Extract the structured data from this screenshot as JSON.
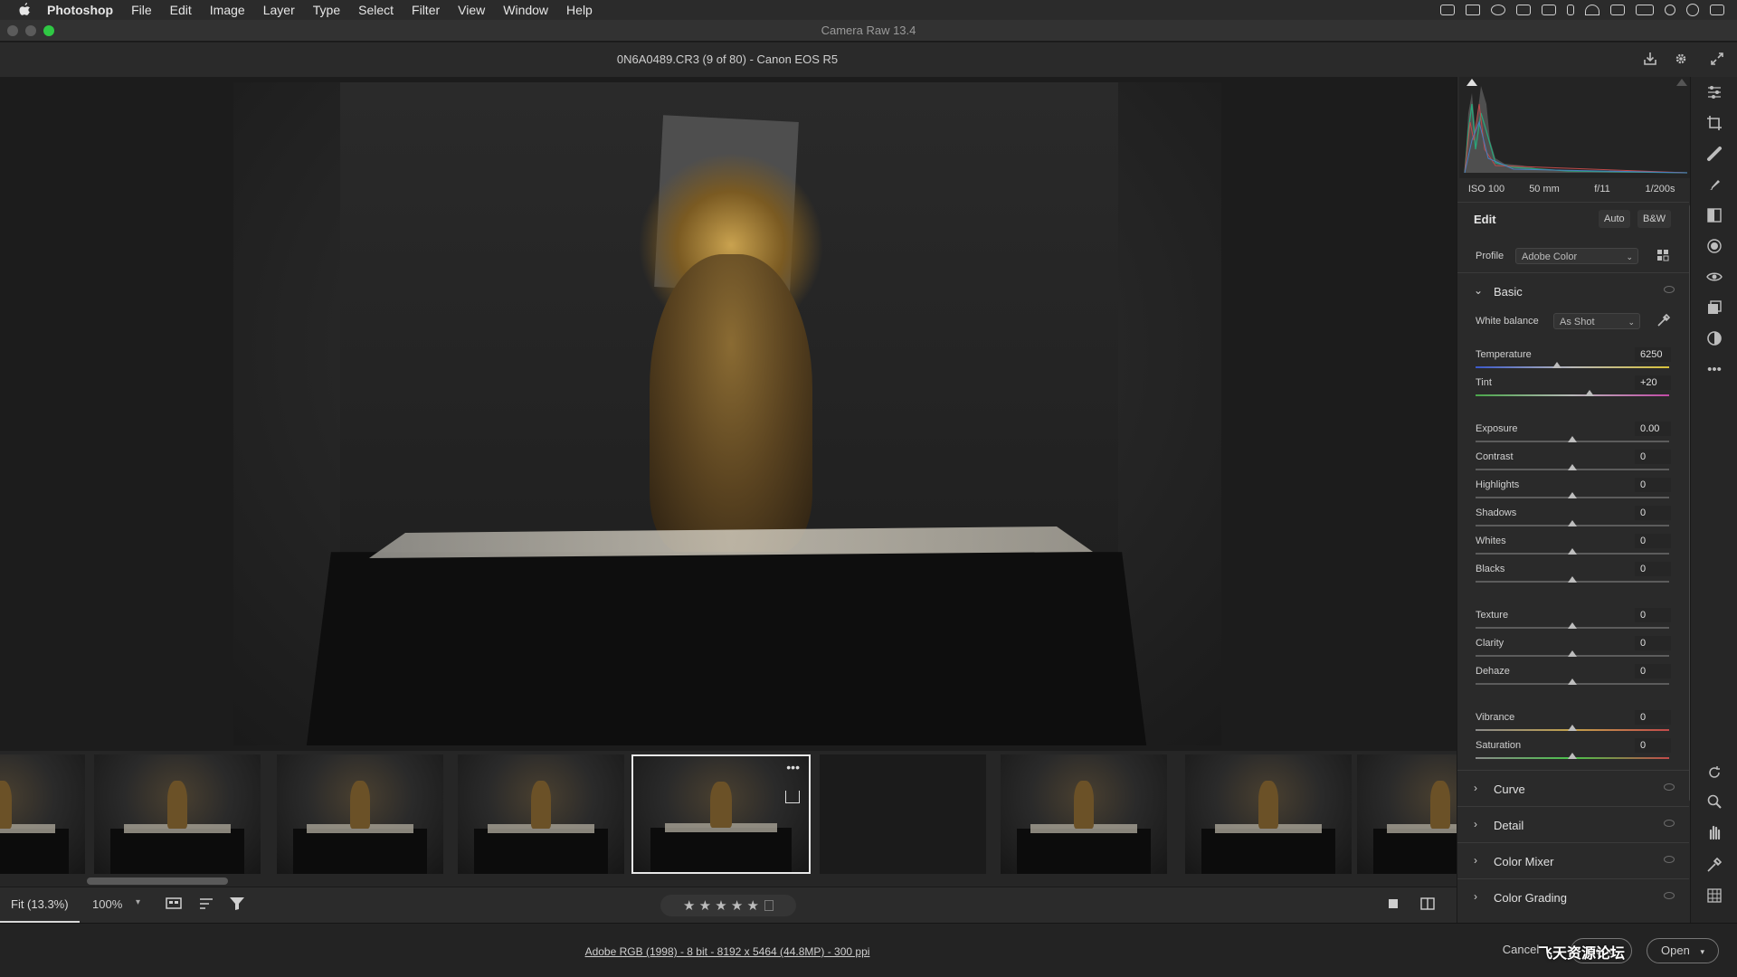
{
  "menubar": {
    "apple_icon": "apple-logo-icon",
    "items": [
      "Photoshop",
      "File",
      "Edit",
      "Image",
      "Layer",
      "Type",
      "Select",
      "Filter",
      "View",
      "Window",
      "Help"
    ]
  },
  "window": {
    "title": "Camera Raw 13.4",
    "traffic_colors": [
      "#5b5b5b",
      "#5b5b5b",
      "#2fc844"
    ]
  },
  "file_header": {
    "filename": "0N6A0489.CR3 (9 of 80)  -  Canon EOS R5",
    "icons": [
      "save-icon",
      "settings-gear-icon",
      "fullscreen-icon"
    ]
  },
  "histogram": {
    "exif": [
      "ISO 100",
      "50 mm",
      "f/11",
      "1/200s"
    ]
  },
  "edit": {
    "title": "Edit",
    "auto_label": "Auto",
    "bw_label": "B&W",
    "profile_label": "Profile",
    "profile_value": "Adobe Color",
    "basic": {
      "title": "Basic",
      "white_balance_label": "White balance",
      "white_balance_value": "As Shot",
      "sliders": [
        {
          "label": "Temperature",
          "value": "6250",
          "pos": 0.42
        },
        {
          "label": "Tint",
          "value": "+20",
          "pos": 0.59
        },
        {
          "label": "Exposure",
          "value": "0.00",
          "pos": 0.5
        },
        {
          "label": "Contrast",
          "value": "0",
          "pos": 0.5
        },
        {
          "label": "Highlights",
          "value": "0",
          "pos": 0.5
        },
        {
          "label": "Shadows",
          "value": "0",
          "pos": 0.5
        },
        {
          "label": "Whites",
          "value": "0",
          "pos": 0.5
        },
        {
          "label": "Blacks",
          "value": "0",
          "pos": 0.5
        },
        {
          "label": "Texture",
          "value": "0",
          "pos": 0.5
        },
        {
          "label": "Clarity",
          "value": "0",
          "pos": 0.5
        },
        {
          "label": "Dehaze",
          "value": "0",
          "pos": 0.5
        },
        {
          "label": "Vibrance",
          "value": "0",
          "pos": 0.5
        },
        {
          "label": "Saturation",
          "value": "0",
          "pos": 0.5
        }
      ]
    },
    "sections": [
      "Curve",
      "Detail",
      "Color Mixer",
      "Color Grading"
    ]
  },
  "bottom_bar": {
    "zoom_fit": "Fit (13.3%)",
    "zoom_pct": "100%",
    "rating_stars": "★ ★ ★ ★ ★"
  },
  "footer": {
    "info": "Adobe RGB (1998) - 8 bit - 8192 x 5464 (44.8MP) - 300 ppi",
    "cancel": "Cancel",
    "done": "Done",
    "open": "Open"
  },
  "watermark": "飞天资源论坛"
}
